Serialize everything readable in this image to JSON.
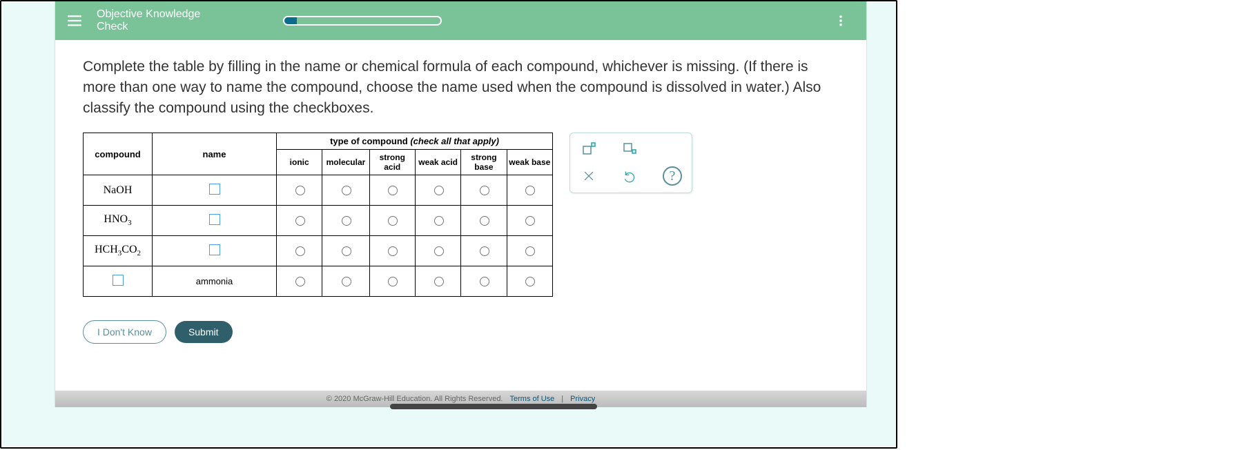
{
  "header": {
    "title_line1": "Objective Knowledge",
    "title_line2": "Check",
    "progress_pct": 8
  },
  "instructions": "Complete the table by filling in the name or chemical formula of each compound, whichever is missing. (If there is more than one way to name the compound, choose the name used when the compound is dissolved in water.) Also classify the compound using the checkboxes.",
  "table": {
    "head_compound": "compound",
    "head_name": "name",
    "head_type_prefix": "type of compound ",
    "head_type_italic": "(check all that apply)",
    "sub_headers": [
      "ionic",
      "molecular",
      "strong acid",
      "weak acid",
      "strong base",
      "weak base"
    ],
    "rows": [
      {
        "compound_html": "NaOH",
        "name": "",
        "name_is_input": true
      },
      {
        "compound_html": "HNO<sub>3</sub>",
        "name": "",
        "name_is_input": true
      },
      {
        "compound_html": "HCH<sub>3</sub>CO<sub>2</sub>",
        "name": "",
        "name_is_input": true
      },
      {
        "compound_html": "",
        "compound_is_input": true,
        "name": "ammonia",
        "name_is_input": false
      }
    ]
  },
  "buttons": {
    "idk": "I Don't Know",
    "submit": "Submit"
  },
  "footer": {
    "copyright": "© 2020 McGraw-Hill Education. All Rights Reserved.",
    "terms": "Terms of Use",
    "privacy": "Privacy"
  }
}
